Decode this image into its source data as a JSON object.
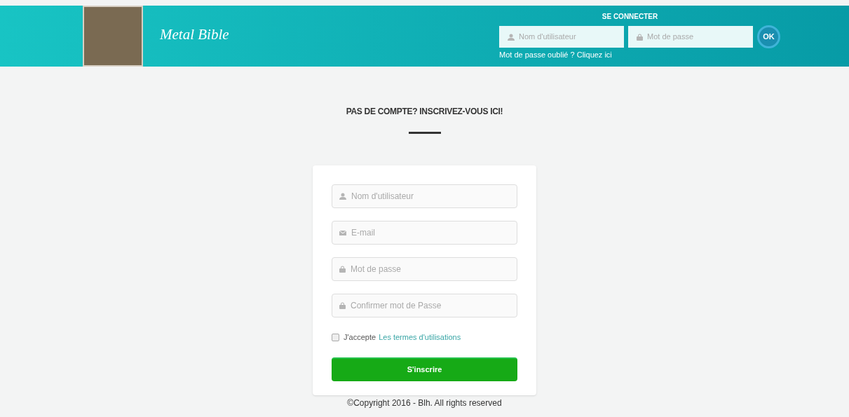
{
  "header": {
    "site_title": "Metal Bible",
    "login": {
      "heading": "SE CONNECTER",
      "fields": [
        {
          "kind": "user",
          "placeholder": "Nom d'utilisateur"
        },
        {
          "kind": "lock",
          "placeholder": "Mot de passe"
        }
      ],
      "submit": "OK",
      "forgot": "Mot de passe oublié ? Cliquez ici"
    }
  },
  "signup": {
    "heading": "PAS DE COMPTE? INSCRIVEZ-VOUS ICI!",
    "fields": [
      {
        "kind": "user",
        "placeholder": "Nom d'utilisateur"
      },
      {
        "kind": "mail",
        "placeholder": "E-mail"
      },
      {
        "kind": "lock",
        "placeholder": "Mot de passe"
      },
      {
        "kind": "lock",
        "placeholder": "Confirmer mot de Passe"
      }
    ],
    "terms": {
      "checked": false,
      "text": "J'accepte",
      "link": "Les termes d'utilisations"
    },
    "submit": "S'inscrire"
  },
  "footer": "©Copyright 2016 - Blh. All rights reserved"
}
